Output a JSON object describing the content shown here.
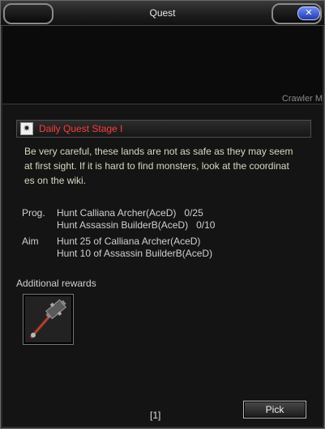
{
  "window": {
    "title": "Quest",
    "close_label": "✕"
  },
  "scene": {
    "monster_label": "Crawler M"
  },
  "quest": {
    "title": "Daily Quest Stage I",
    "icon_glyph": "✷",
    "description_lines": [
      "Be very careful, these lands are not as safe as they may seem",
      " at first sight. If it is hard to find monsters, look at the coordinat",
      "es on the wiki."
    ],
    "progress_label": "Prog.",
    "progress": [
      {
        "text": "Hunt Calliana Archer(AceD)",
        "count": "0/25"
      },
      {
        "text": "Hunt Assassin BuilderB(AceD)",
        "count": "0/10"
      }
    ],
    "aim_label": "Aim",
    "aim": [
      "Hunt 25 of Calliana Archer(AceD)",
      "Hunt 10 of Assassin BuilderB(AceD)"
    ]
  },
  "rewards": {
    "label": "Additional rewards",
    "item_icon": "mace-icon"
  },
  "footer": {
    "page": "[1]",
    "pick_label": "Pick"
  }
}
